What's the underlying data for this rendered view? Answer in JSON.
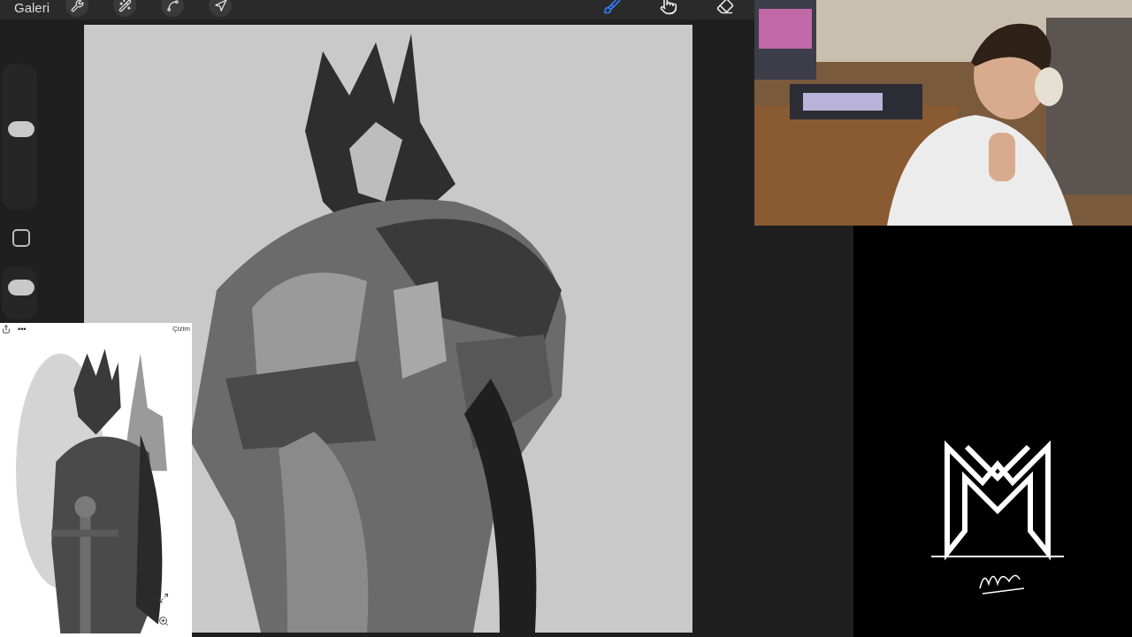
{
  "toolbar": {
    "gallery": "Galeri",
    "tools": [
      {
        "kind": "wrench"
      },
      {
        "kind": "wand"
      },
      {
        "kind": "selection"
      },
      {
        "kind": "transform"
      }
    ],
    "brush_tools": [
      {
        "kind": "brush",
        "selected": true
      },
      {
        "kind": "smudge",
        "selected": false
      },
      {
        "kind": "eraser",
        "selected": false
      }
    ]
  },
  "sidebar": {
    "size": {
      "level": 0.55
    },
    "opacity": {
      "level": 0.6
    }
  },
  "reference": {
    "menu": "•••",
    "title": "Çizim"
  }
}
